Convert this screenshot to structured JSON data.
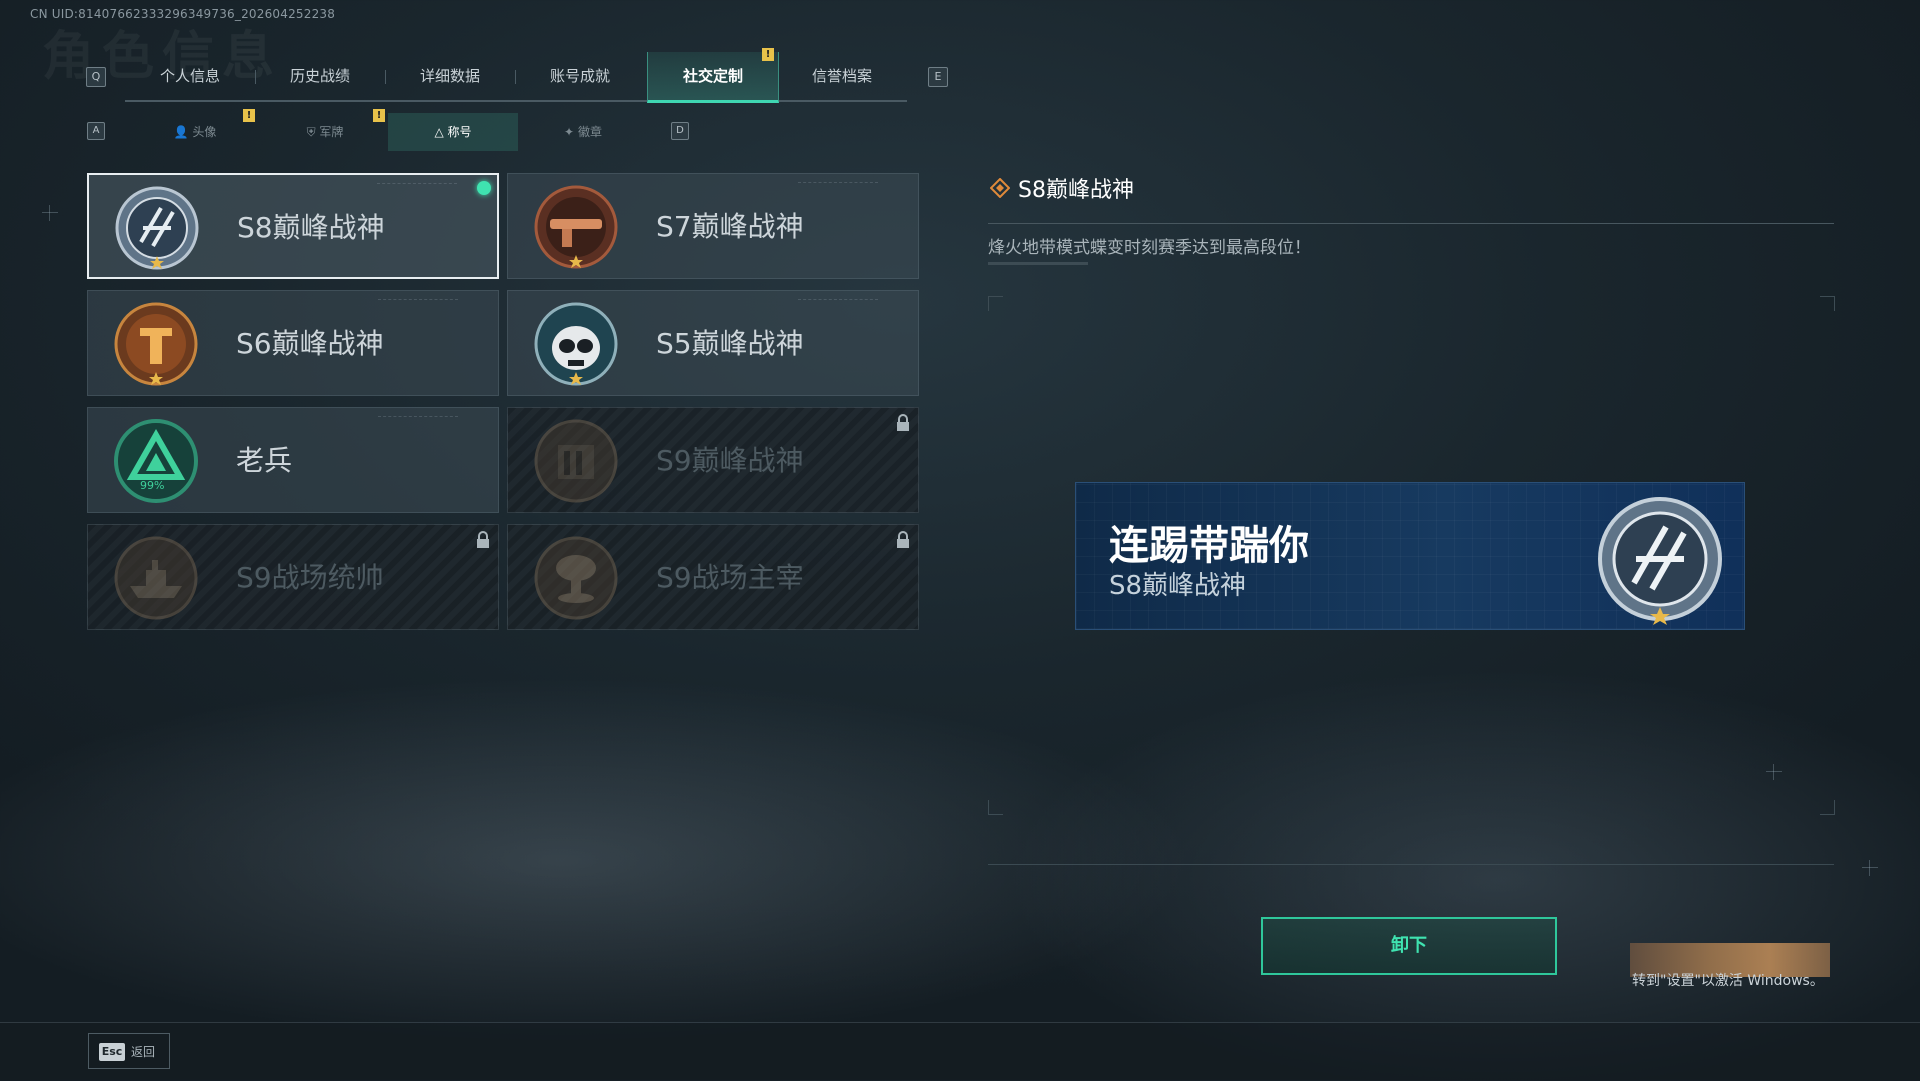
{
  "uid_text": "CN UID:81407662333296349736_202604252238",
  "top_tabs": {
    "left_key": "Q",
    "right_key": "E",
    "items": [
      {
        "label": "个人信息"
      },
      {
        "label": "历史战绩"
      },
      {
        "label": "详细数据"
      },
      {
        "label": "账号成就"
      },
      {
        "label": "社交定制",
        "active": true,
        "notice": "!"
      },
      {
        "label": "信誉档案"
      }
    ]
  },
  "sub_tabs": {
    "left_key": "A",
    "right_key": "D",
    "items": [
      {
        "label": "头像",
        "icon": "person-icon",
        "notice": "!"
      },
      {
        "label": "军牌",
        "icon": "dogtag-icon",
        "notice": "!"
      },
      {
        "label": "称号",
        "icon": "triangle-icon",
        "active": true
      },
      {
        "label": "徽章",
        "icon": "badge-icon"
      }
    ]
  },
  "titles": [
    {
      "label": "S8巅峰战神",
      "emblem": "s8-emblem",
      "selected": true,
      "equipped": true,
      "locked": false
    },
    {
      "label": "S7巅峰战神",
      "emblem": "s7-emblem",
      "locked": false
    },
    {
      "label": "S6巅峰战神",
      "emblem": "s6-emblem",
      "locked": false
    },
    {
      "label": "S5巅峰战神",
      "emblem": "s5-emblem",
      "locked": false
    },
    {
      "label": "老兵",
      "emblem": "veteran-emblem",
      "locked": false,
      "progress_text": "99%"
    },
    {
      "label": "S9巅峰战神",
      "emblem": "s9-emblem",
      "locked": true
    },
    {
      "label": "S9战场统帅",
      "emblem": "ship-emblem",
      "locked": true
    },
    {
      "label": "S9战场主宰",
      "emblem": "mushroom-cloud-emblem",
      "locked": true
    }
  ],
  "detail": {
    "title": "S8巅峰战神",
    "description": "烽火地带模式蝶变时刻赛季达到最高段位！"
  },
  "preview": {
    "player_name": "连踢带踹你",
    "title": "S8巅峰战神"
  },
  "action": {
    "unequip_label": "卸下"
  },
  "windows": {
    "activate_text": "转到\"设置\"以激活 Windows。"
  },
  "footer": {
    "esc_key": "Esc",
    "back_label": "返回"
  },
  "colors": {
    "accent": "#3fe3b0",
    "notice": "#e8c24a",
    "banner": "#173a60"
  }
}
